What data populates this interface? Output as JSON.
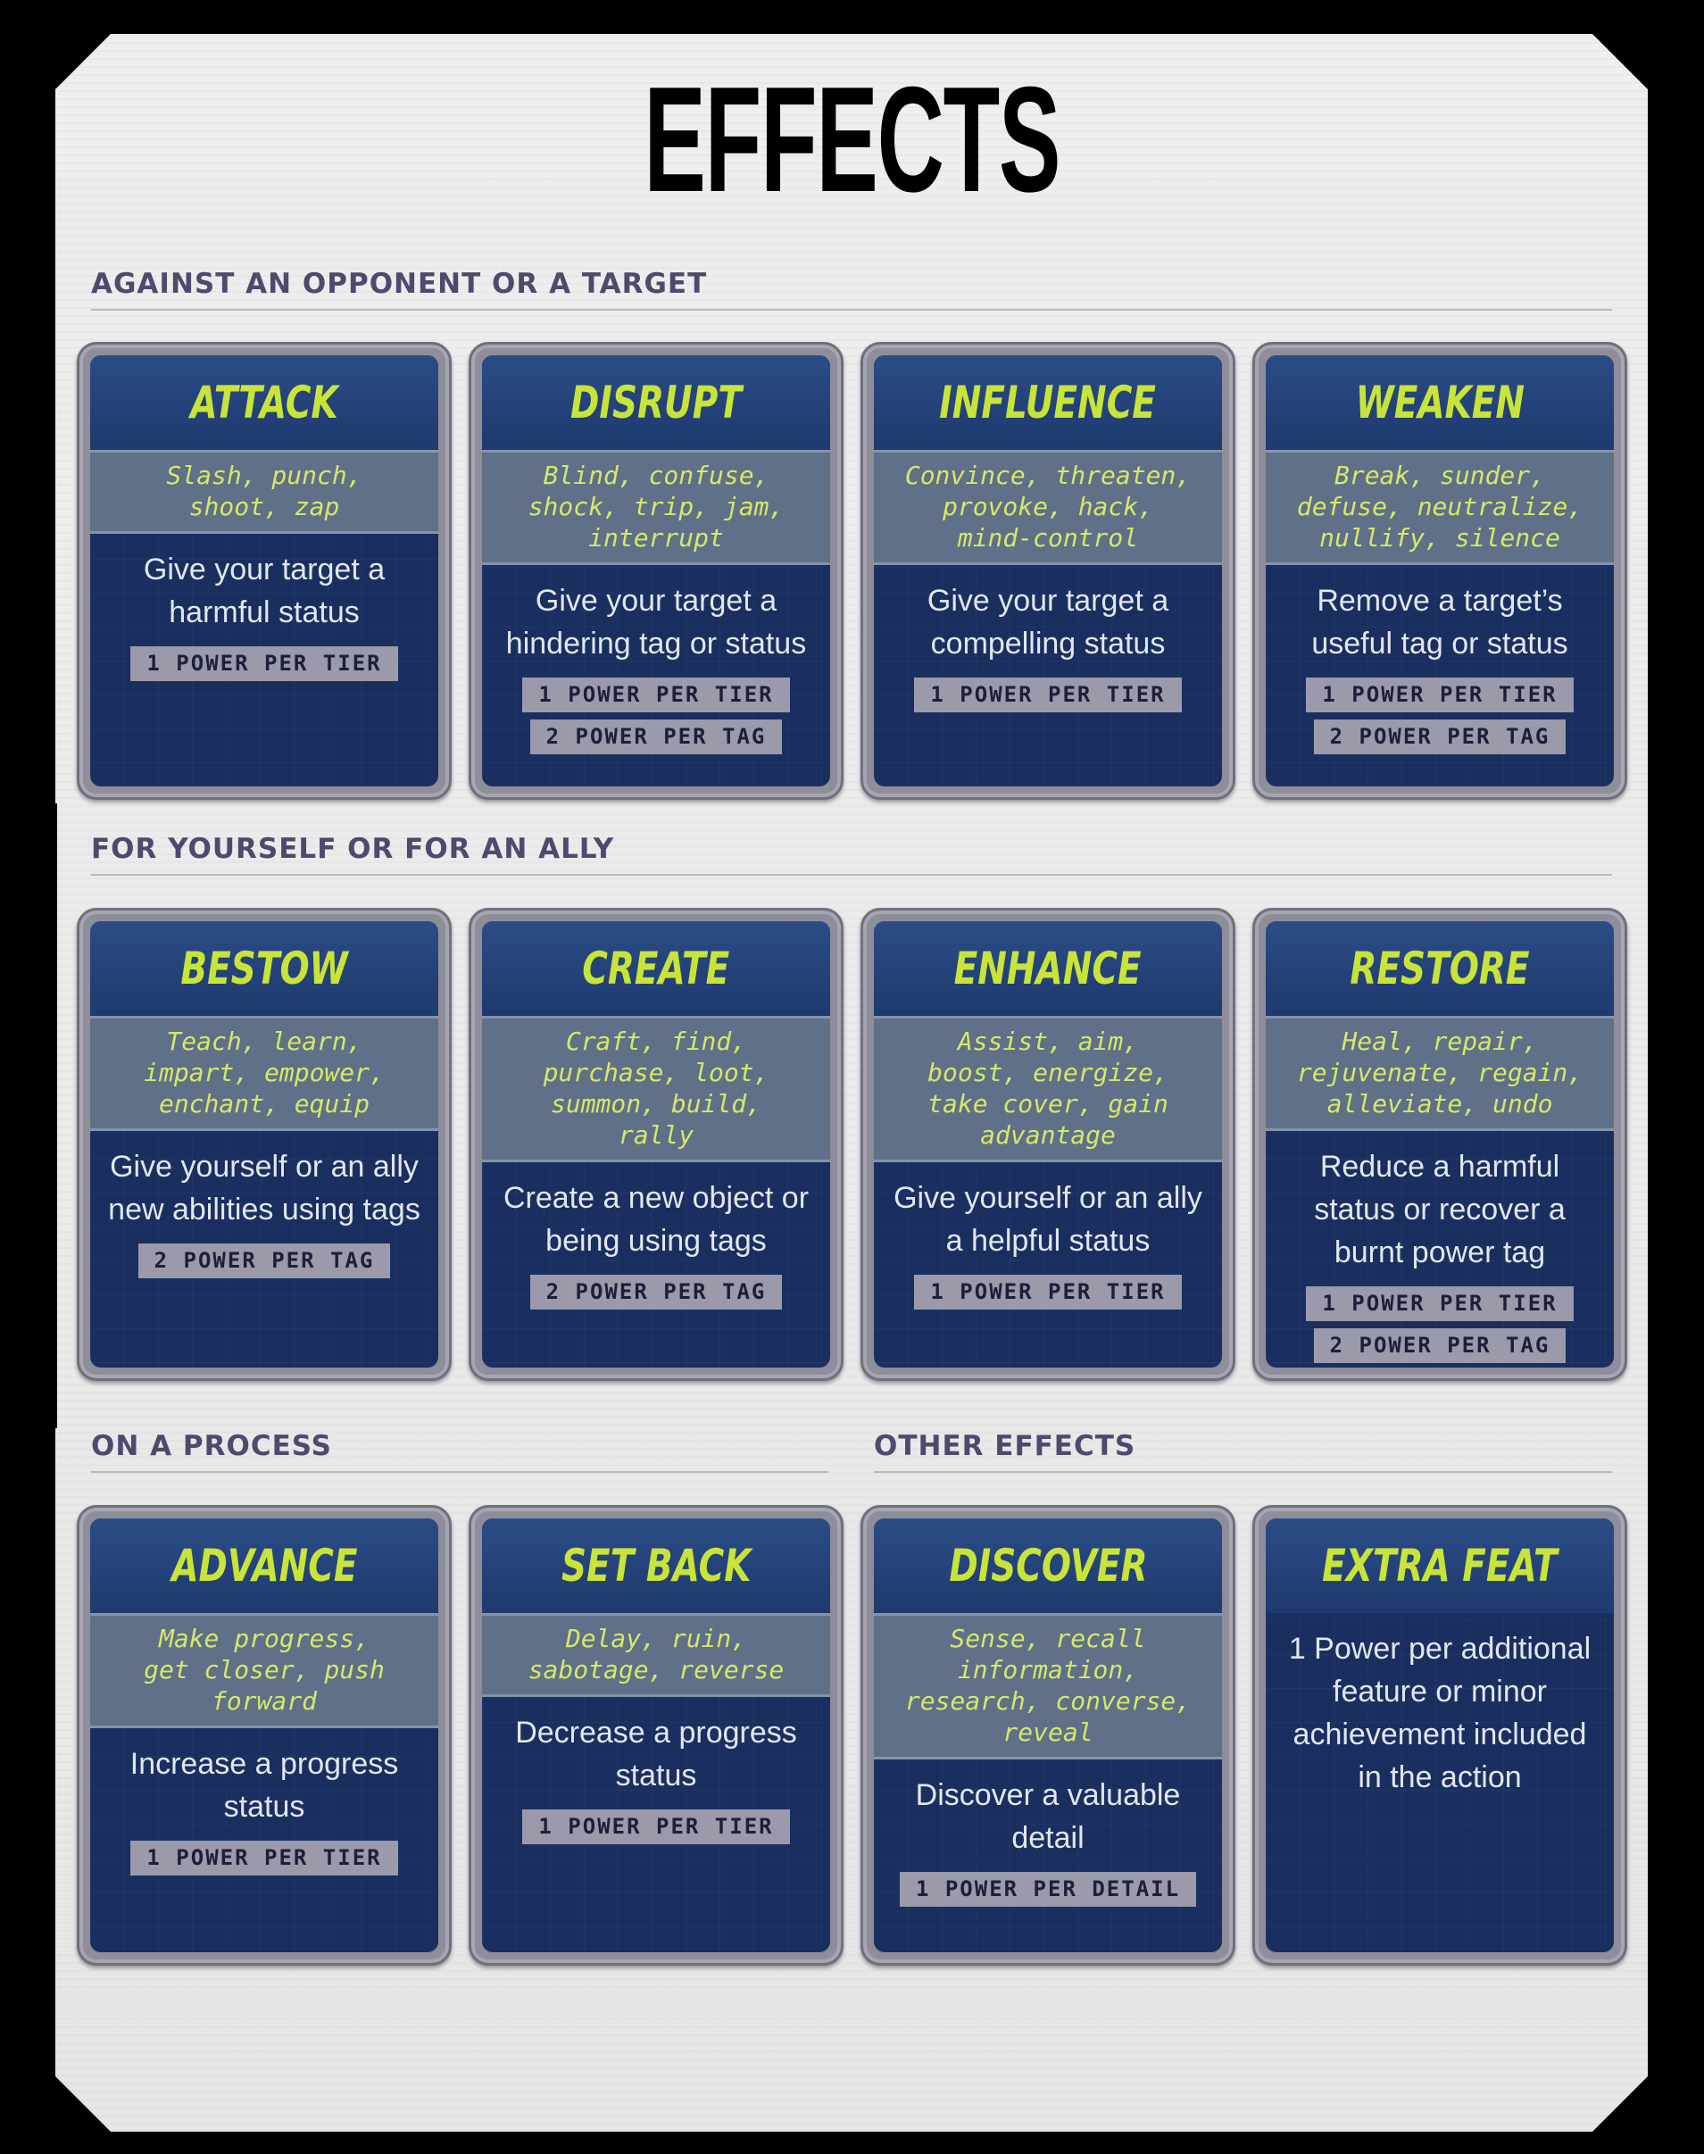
{
  "title": "EFFECTS",
  "sections": {
    "opponent": "AGAINST AN OPPONENT OR A TARGET",
    "ally": "FOR YOURSELF OR FOR AN ALLY",
    "process": "ON A PROCESS",
    "other": "OTHER EFFECTS"
  },
  "cards": [
    {
      "title": "ATTACK",
      "verbs": "Slash, punch,\nshoot, zap",
      "desc": "Give your target a harmful status",
      "costs": [
        "1 POWER PER TIER"
      ]
    },
    {
      "title": "DISRUPT",
      "verbs": "Blind, confuse,\nshock, trip, jam,\ninterrupt",
      "desc": "Give your target a hindering tag or status",
      "costs": [
        "1 POWER PER TIER",
        "2 POWER PER TAG"
      ]
    },
    {
      "title": "INFLUENCE",
      "verbs": "Convince, threaten,\nprovoke, hack,\nmind-control",
      "desc": "Give your target a compelling status",
      "costs": [
        "1 POWER PER TIER"
      ]
    },
    {
      "title": "WEAKEN",
      "verbs": "Break, sunder,\ndefuse, neutralize,\nnullify, silence",
      "desc": "Remove a target’s useful tag or status",
      "costs": [
        "1 POWER PER TIER",
        "2 POWER PER TAG"
      ]
    },
    {
      "title": "BESTOW",
      "verbs": "Teach, learn,\nimpart, empower,\nenchant, equip",
      "desc": "Give yourself or an ally new abilities using tags",
      "costs": [
        "2 POWER PER TAG"
      ]
    },
    {
      "title": "CREATE",
      "verbs": "Craft, find,\npurchase, loot,\nsummon, build,\nrally",
      "desc": "Create a new object or being using tags",
      "costs": [
        "2 POWER PER TAG"
      ]
    },
    {
      "title": "ENHANCE",
      "verbs": "Assist, aim,\nboost, energize,\ntake cover, gain\nadvantage",
      "desc": "Give yourself or an ally a helpful status",
      "costs": [
        "1 POWER PER TIER"
      ]
    },
    {
      "title": "RESTORE",
      "verbs": "Heal, repair,\nrejuvenate, regain,\nalleviate, undo",
      "desc": "Reduce a harmful status or recover a burnt power tag",
      "costs": [
        "1 POWER PER TIER",
        "2 POWER PER TAG"
      ]
    },
    {
      "title": "ADVANCE",
      "verbs": "Make progress,\nget closer, push\nforward",
      "desc": "Increase a progress status",
      "costs": [
        "1 POWER PER TIER"
      ]
    },
    {
      "title": "SET BACK",
      "verbs": "Delay, ruin,\nsabotage, reverse",
      "desc": "Decrease a progress status",
      "costs": [
        "1 POWER PER TIER"
      ]
    },
    {
      "title": "DISCOVER",
      "verbs": "Sense, recall\ninformation,\nresearch, converse,\nreveal",
      "desc": "Discover a valuable detail",
      "costs": [
        "1 POWER PER DETAIL"
      ]
    },
    {
      "title": "EXTRA FEAT",
      "verbs": "",
      "desc": "1 Power per additional feature or minor achievement included in the action",
      "costs": []
    }
  ]
}
